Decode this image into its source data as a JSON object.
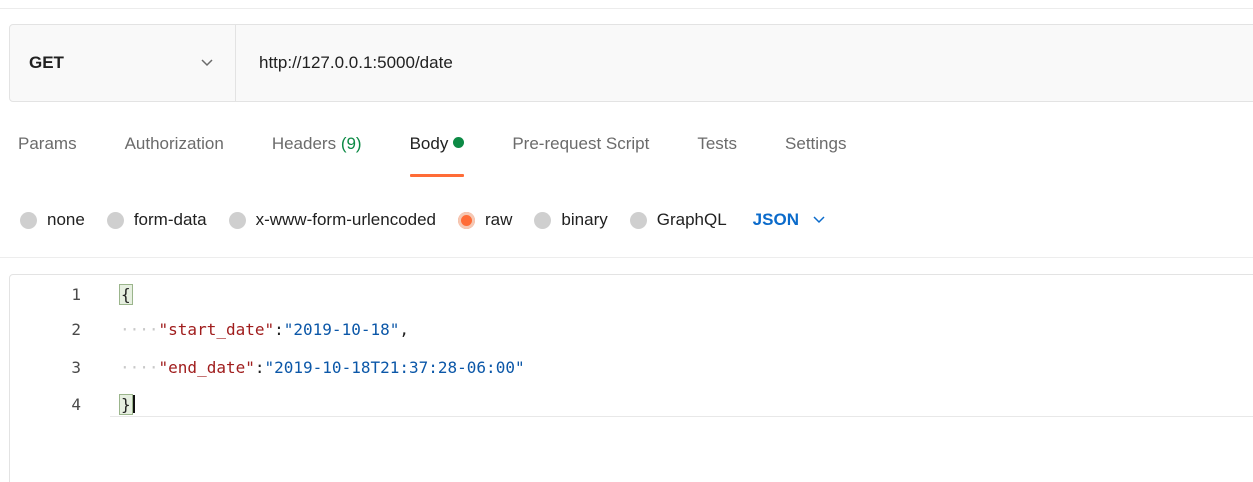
{
  "request": {
    "method": "GET",
    "url": "http://127.0.0.1:5000/date"
  },
  "tabs": [
    {
      "label": "Params"
    },
    {
      "label": "Authorization"
    },
    {
      "label": "Headers",
      "count": "(9)"
    },
    {
      "label": "Body",
      "active": true
    },
    {
      "label": "Pre-request Script"
    },
    {
      "label": "Tests"
    },
    {
      "label": "Settings"
    }
  ],
  "body_types": [
    {
      "label": "none"
    },
    {
      "label": "form-data"
    },
    {
      "label": "x-www-form-urlencoded"
    },
    {
      "label": "raw",
      "selected": true
    },
    {
      "label": "binary"
    },
    {
      "label": "GraphQL"
    }
  ],
  "format": "JSON",
  "editor": {
    "lines": [
      {
        "num": "1",
        "text": "{"
      },
      {
        "num": "2",
        "indent": "····",
        "key": "\"start_date\"",
        "sep": ":",
        "value": "\"2019-10-18\"",
        "trail": ","
      },
      {
        "num": "3",
        "indent": "····",
        "key": "\"end_date\"",
        "sep": ":",
        "value": "\"2019-10-18T21:37:28-06:00\"",
        "trail": ""
      },
      {
        "num": "4",
        "text": "}"
      }
    ]
  },
  "colors": {
    "accent": "#ff6c37",
    "active_dot": "#0c8a45",
    "format": "#0b6bcb",
    "json_key": "#a01d1d",
    "json_string": "#0b57a8"
  },
  "icons": {
    "method_dropdown": "chevron-down-icon",
    "format_dropdown": "chevron-down-icon"
  }
}
